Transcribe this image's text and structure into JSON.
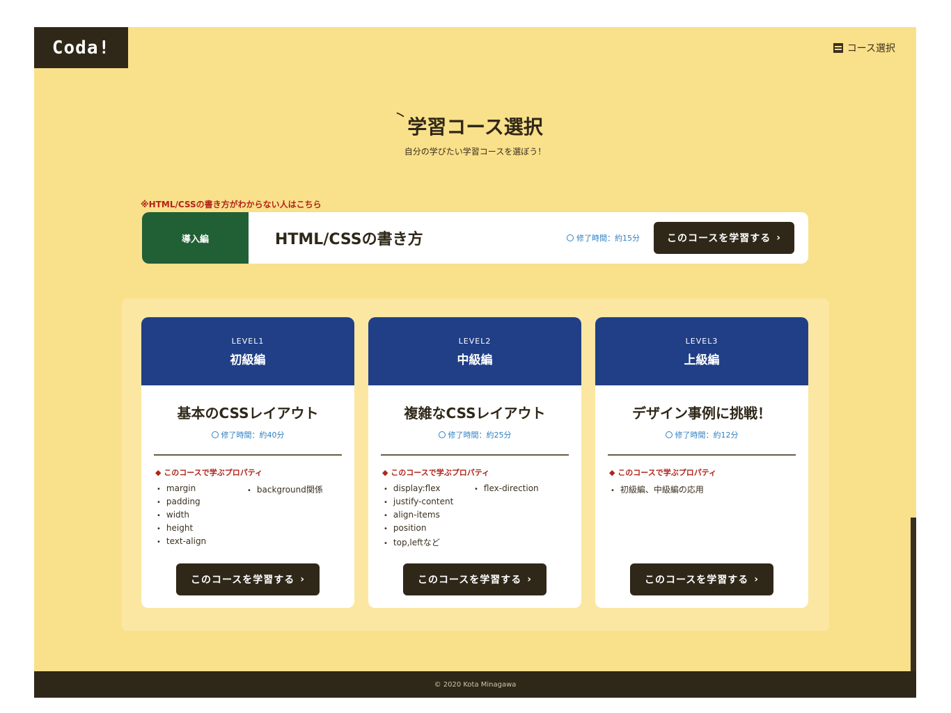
{
  "header": {
    "logo": "Coda!",
    "nav_course_label": "コース選択"
  },
  "hero": {
    "title": "学習コース選択",
    "subtitle": "自分の学びたい学習コースを選ぼう！"
  },
  "intro": {
    "link_text": "※HTML/CSSの書き方がわからない人はこちら",
    "badge": "導入編",
    "title": "HTML/CSSの書き方",
    "time": "修了時間：約15分",
    "button": "このコースを学習する"
  },
  "courses": [
    {
      "level": "LEVEL1",
      "level_name": "初級編",
      "title": "基本のCSSレイアウト",
      "time": "修了時間：約40分",
      "props_label": "◆ このコースで学ぶプロパティ",
      "props": [
        "margin",
        "padding",
        "width",
        "height",
        "text-align",
        "background関係"
      ],
      "button": "このコースを学習する"
    },
    {
      "level": "LEVEL2",
      "level_name": "中級編",
      "title": "複雑なCSSレイアウト",
      "time": "修了時間：約25分",
      "props_label": "◆ このコースで学ぶプロパティ",
      "props": [
        "display:flex",
        "justify-content",
        "align-items",
        "position",
        "top,leftなど",
        "flex-direction"
      ],
      "button": "このコースを学習する"
    },
    {
      "level": "LEVEL3",
      "level_name": "上級編",
      "title": "デザイン事例に挑戦！",
      "time": "修了時間：約12分",
      "props_label": "◆ このコースで学ぶプロパティ",
      "props": [
        "初級編、中級編の応用"
      ],
      "button": "このコースを学習する"
    }
  ],
  "footer": {
    "copyright": "© 2020 Kota Minagawa"
  }
}
